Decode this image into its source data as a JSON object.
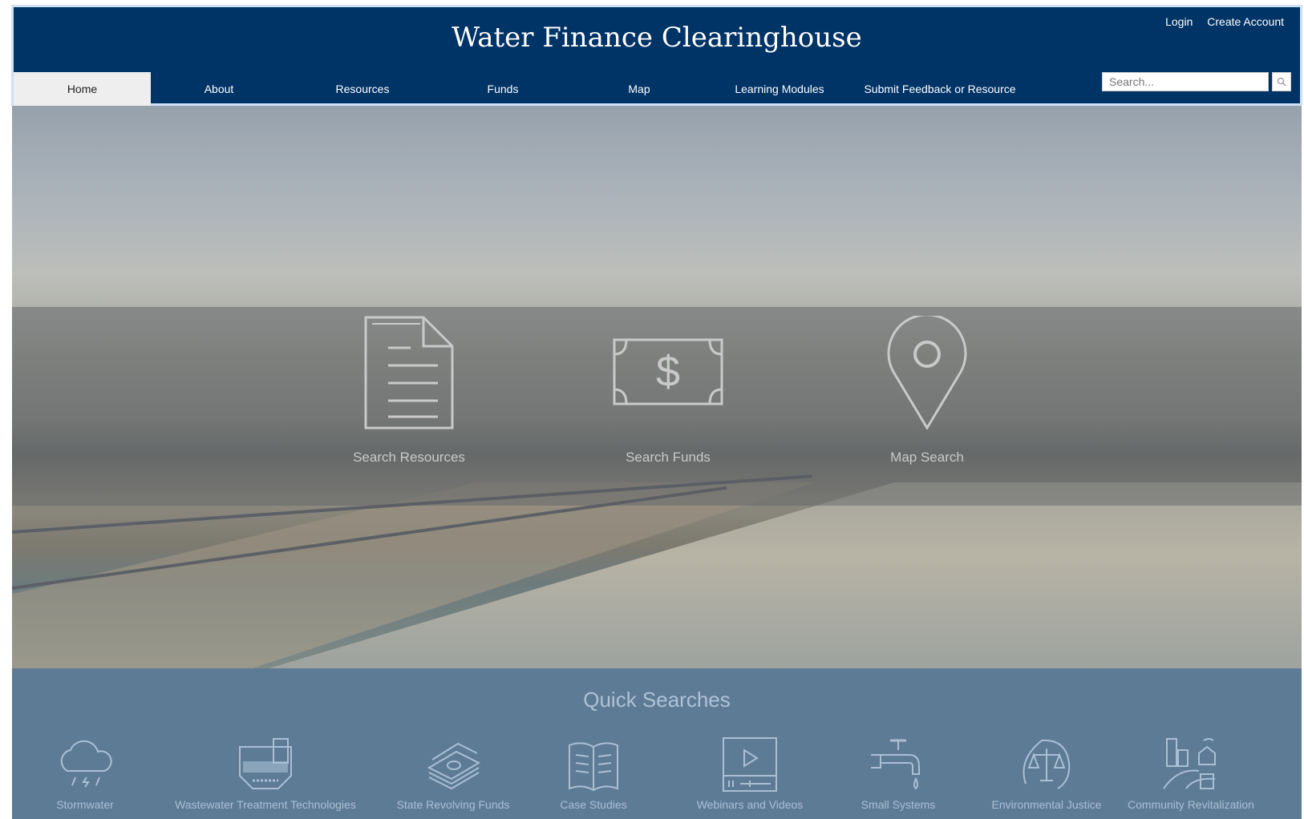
{
  "header": {
    "title": "Water Finance Clearinghouse",
    "login": "Login",
    "create_account": "Create Account"
  },
  "nav": {
    "items": [
      {
        "label": "Home",
        "active": true
      },
      {
        "label": "About"
      },
      {
        "label": "Resources"
      },
      {
        "label": "Funds"
      },
      {
        "label": "Map"
      },
      {
        "label": "Learning Modules"
      },
      {
        "label": "Submit Feedback or Resource"
      }
    ]
  },
  "search": {
    "placeholder": "Search...",
    "icon": "search-icon"
  },
  "hero": {
    "actions": [
      {
        "label": "Search Resources",
        "icon": "document-icon"
      },
      {
        "label": "Search Funds",
        "icon": "dollar-bill-icon"
      },
      {
        "label": "Map Search",
        "icon": "map-pin-icon"
      }
    ]
  },
  "quick_searches": {
    "title": "Quick Searches",
    "items": [
      {
        "label": "Stormwater",
        "icon": "rain-cloud-icon"
      },
      {
        "label": "Wastewater Treatment Technologies",
        "icon": "treatment-tank-icon"
      },
      {
        "label": "State Revolving Funds",
        "icon": "money-stack-icon"
      },
      {
        "label": "Case Studies",
        "icon": "open-book-icon"
      },
      {
        "label": "Webinars and Videos",
        "icon": "video-player-icon"
      },
      {
        "label": "Small Systems",
        "icon": "faucet-icon"
      },
      {
        "label": "Environmental Justice",
        "icon": "scales-icon"
      },
      {
        "label": "Community Revitalization",
        "icon": "city-icon"
      }
    ]
  },
  "colors": {
    "header_bg": "#003366",
    "quick_bg": "#5e7b96",
    "active_tab": "#eeeeee"
  }
}
